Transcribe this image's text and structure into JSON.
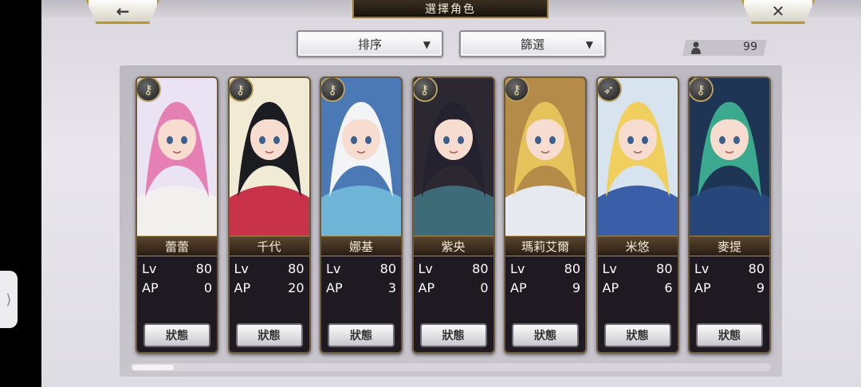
{
  "header": {
    "title": "選擇角色",
    "back_icon": "←",
    "close_icon": "✕"
  },
  "controls": {
    "sort_label": "排序",
    "filter_label": "篩選",
    "caret": "▼",
    "owned_count": "99"
  },
  "edge_tab_glyph": "⟩",
  "characters": [
    {
      "name": "蕾蕾",
      "lv_label": "Lv",
      "lv": "80",
      "ap_label": "AP",
      "ap": "0",
      "status": "狀態",
      "weapon_icon": "key-weapon-icon",
      "hair": "#e67fb3",
      "outfit": "#f2f0ee",
      "bg": "#e9e3f3"
    },
    {
      "name": "千代",
      "lv_label": "Lv",
      "lv": "80",
      "ap_label": "AP",
      "ap": "20",
      "status": "狀態",
      "weapon_icon": "key-weapon-icon",
      "hair": "#1b1b22",
      "outfit": "#c8334a",
      "bg": "#f1ead4"
    },
    {
      "name": "娜基",
      "lv_label": "Lv",
      "lv": "80",
      "ap_label": "AP",
      "ap": "3",
      "status": "狀態",
      "weapon_icon": "key-weapon-icon",
      "hair": "#f2f4f6",
      "outfit": "#6fb5d8",
      "bg": "#4a79b5"
    },
    {
      "name": "紫央",
      "lv_label": "Lv",
      "lv": "80",
      "ap_label": "AP",
      "ap": "0",
      "status": "狀態",
      "weapon_icon": "key-weapon-icon",
      "hair": "#24222e",
      "outfit": "#3d6b78",
      "bg": "#2c2832"
    },
    {
      "name": "瑪莉艾爾",
      "lv_label": "Lv",
      "lv": "80",
      "ap_label": "AP",
      "ap": "9",
      "status": "狀態",
      "weapon_icon": "key-weapon-icon",
      "hair": "#e6c35a",
      "outfit": "#e7e9f0",
      "bg": "#b58b4a"
    },
    {
      "name": "米悠",
      "lv_label": "Lv",
      "lv": "80",
      "ap_label": "AP",
      "ap": "6",
      "status": "狀態",
      "weapon_icon": "bow-weapon-icon",
      "hair": "#f0cf5e",
      "outfit": "#3a5ea8",
      "bg": "#d7e3ee"
    },
    {
      "name": "麥提",
      "lv_label": "Lv",
      "lv": "80",
      "ap_label": "AP",
      "ap": "9",
      "status": "狀態",
      "weapon_icon": "key-weapon-icon",
      "hair": "#3aa98d",
      "outfit": "#27467a",
      "bg": "#1f3556"
    }
  ]
}
